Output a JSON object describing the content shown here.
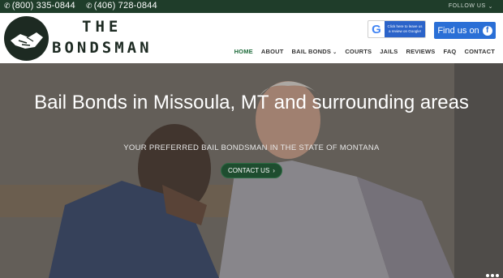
{
  "topbar": {
    "phone1": "(800) 335-0844",
    "phone2": "(406) 728-0844",
    "follow": "FOLLOW US",
    "follow_caret": "⌄"
  },
  "header": {
    "logo_the": "THE",
    "logo_bondsman": "BONDSMAN",
    "google_badge": "Click here to leave us a review on Google!",
    "facebook_badge": "Find us on",
    "facebook_icon": "f"
  },
  "nav": {
    "items": [
      "HOME",
      "ABOUT",
      "BAIL BONDS",
      "COURTS",
      "JAILS",
      "REVIEWS",
      "FAQ",
      "CONTACT"
    ],
    "caret": "⌄"
  },
  "hero": {
    "title": "Bail Bonds in Missoula, MT and surrounding areas",
    "subtitle": "YOUR PREFERRED BAIL BONDSMAN IN THE STATE OF MONTANA",
    "button": "CONTACT US",
    "button_arrow": "›"
  },
  "colors": {
    "topbar": "#1f3d2a",
    "accent": "#1e6b3a",
    "facebook": "#2a6fd6"
  }
}
